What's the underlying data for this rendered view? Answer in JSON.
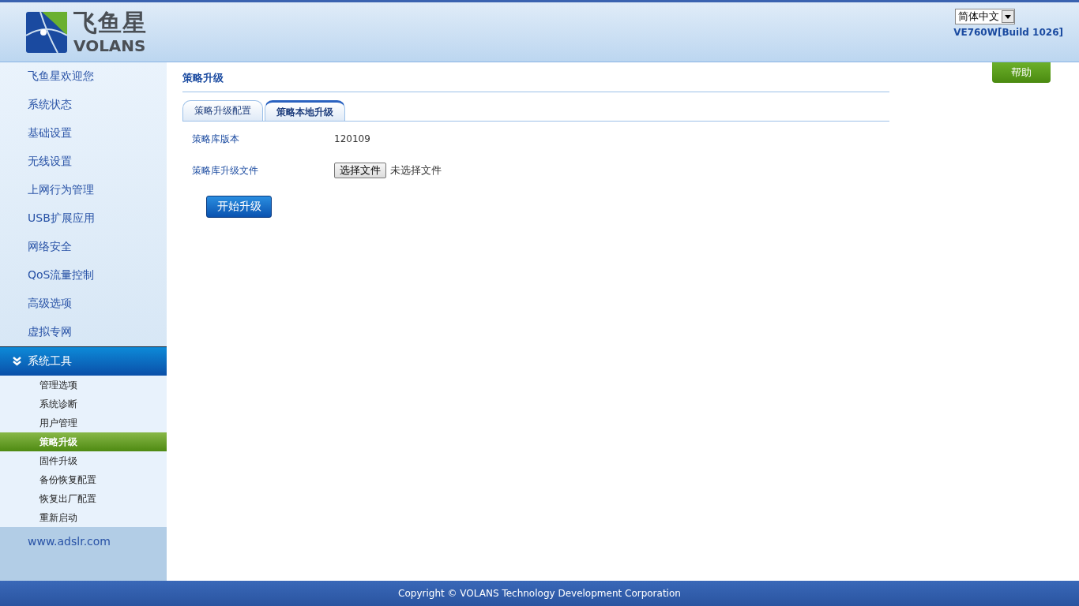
{
  "header": {
    "logo_cn": "飞鱼星",
    "logo_en": "VOLANS",
    "language": "简体中文",
    "version": "VE760W[Build 1026]"
  },
  "sidebar": {
    "items": [
      {
        "label": "飞鱼星欢迎您",
        "expanded": false
      },
      {
        "label": "系统状态",
        "expanded": false
      },
      {
        "label": "基础设置",
        "expanded": false
      },
      {
        "label": "无线设置",
        "expanded": false
      },
      {
        "label": "上网行为管理",
        "expanded": false
      },
      {
        "label": "USB扩展应用",
        "expanded": false
      },
      {
        "label": "网络安全",
        "expanded": false
      },
      {
        "label": "QoS流量控制",
        "expanded": false
      },
      {
        "label": "高级选项",
        "expanded": false
      },
      {
        "label": "虚拟专网",
        "expanded": false
      },
      {
        "label": "系统工具",
        "expanded": true,
        "children": [
          {
            "label": "管理选项",
            "selected": false
          },
          {
            "label": "系统诊断",
            "selected": false
          },
          {
            "label": "用户管理",
            "selected": false
          },
          {
            "label": "策略升级",
            "selected": true
          },
          {
            "label": "固件升级",
            "selected": false
          },
          {
            "label": "备份恢复配置",
            "selected": false
          },
          {
            "label": "恢复出厂配置",
            "selected": false
          },
          {
            "label": "重新启动",
            "selected": false
          }
        ]
      }
    ],
    "link": "www.adslr.com"
  },
  "page": {
    "title": "策略升级",
    "help": "帮助",
    "tabs": [
      {
        "label": "策略升级配置",
        "selected": false
      },
      {
        "label": "策略本地升级",
        "selected": true
      }
    ],
    "fields": [
      {
        "label": "策略库版本",
        "kind": "text",
        "value": "120109"
      },
      {
        "label": "策略库升级文件",
        "kind": "file",
        "button": "选择文件",
        "value": "未选择文件"
      }
    ],
    "submit": "开始升级"
  },
  "footer": "Copyright © VOLANS Technology Development Corporation"
}
